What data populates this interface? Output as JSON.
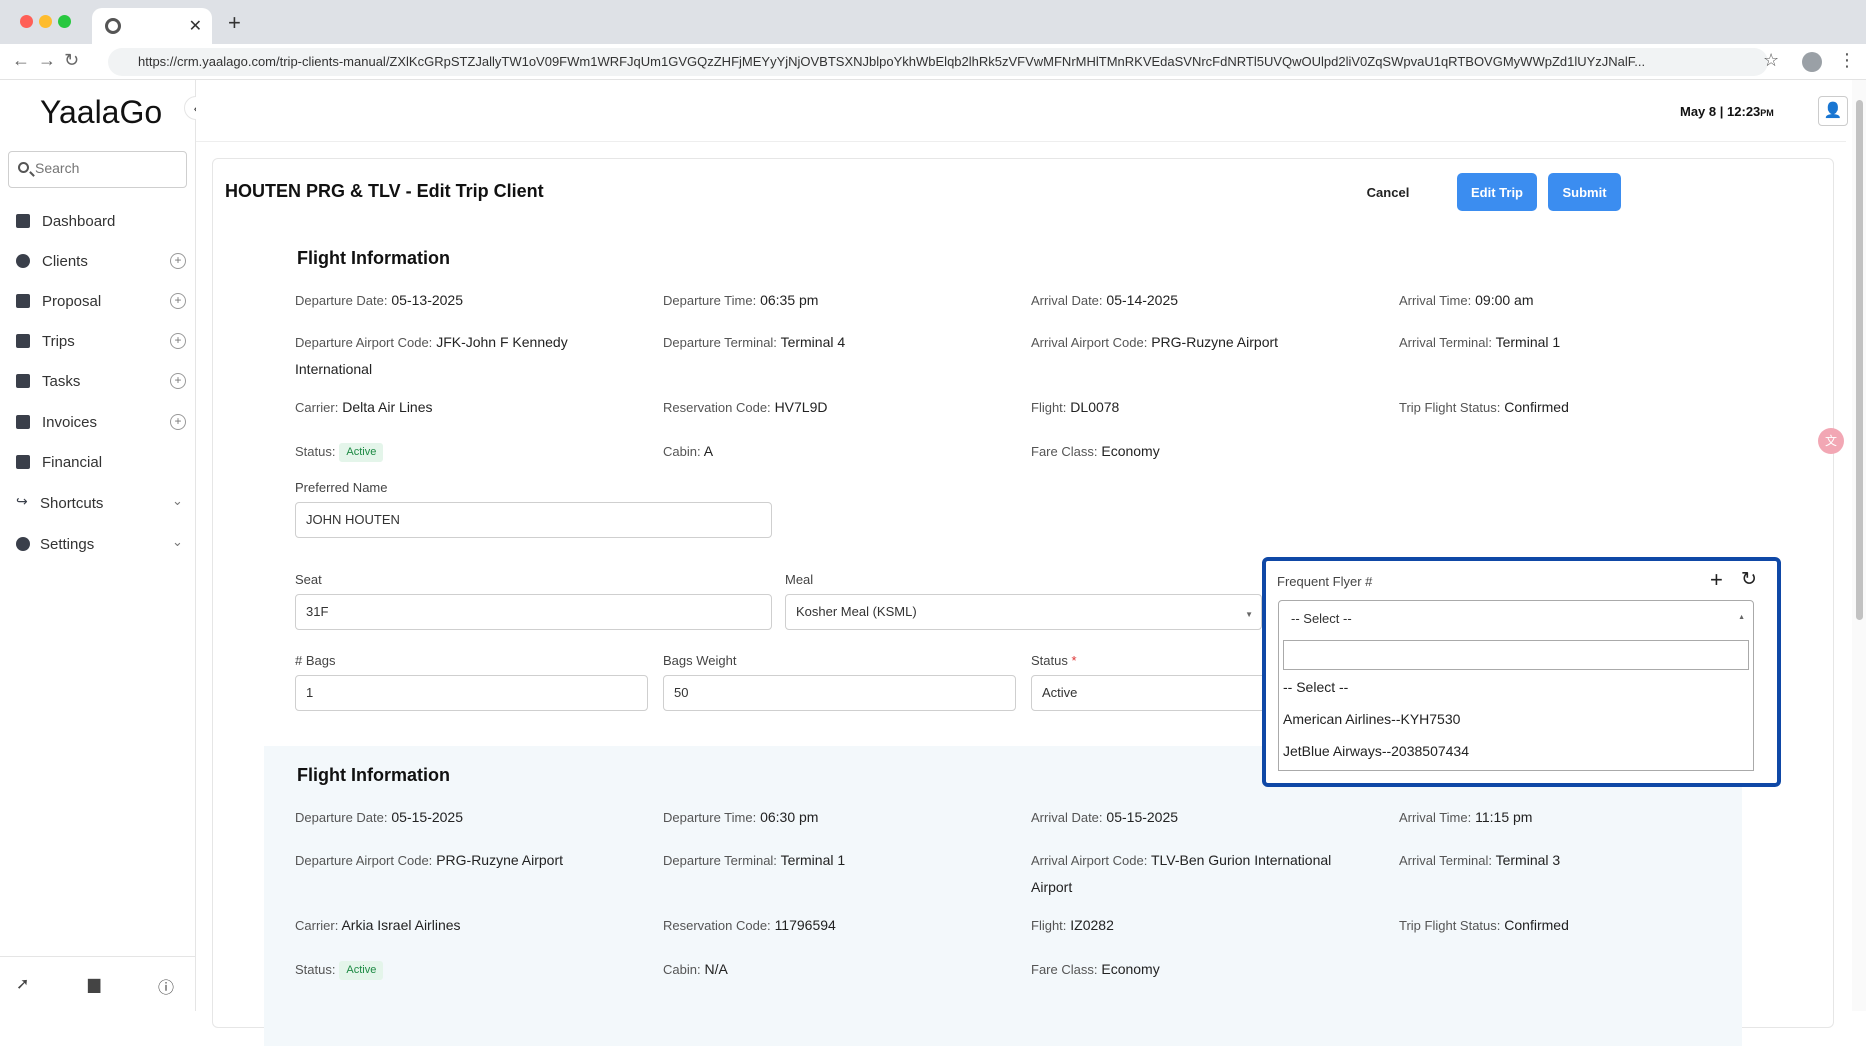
{
  "browser": {
    "tab_close": "✕",
    "new_tab": "+",
    "url": "https://crm.yaalago.com/trip-clients-manual/ZXlKcGRpSTZJallyTW1oV09FWm1WRFJqUm1GVGQzZHFjMEYyYjNjOVBTSXNJblpoYkhWbElqb2lhRk5zVFVwMFNrMHlTMnRKVEdaSVNrcFdNRTl5UVQwOUlpd2liV0ZqSWpvaU1qRTBOVGMyWWpZd1lUYzJNalF..."
  },
  "sidebar": {
    "logo": "YaalaGo",
    "search_placeholder": "Search",
    "items": [
      {
        "label": "Dashboard"
      },
      {
        "label": "Clients"
      },
      {
        "label": "Proposal"
      },
      {
        "label": "Trips"
      },
      {
        "label": "Tasks"
      },
      {
        "label": "Invoices"
      },
      {
        "label": "Financial"
      },
      {
        "label": "Shortcuts"
      },
      {
        "label": "Settings"
      }
    ]
  },
  "header": {
    "date": "May 8",
    "separator": "|",
    "time": "12:23",
    "ampm": "PM"
  },
  "page": {
    "title": "HOUTEN PRG & TLV - Edit Trip Client",
    "cancel": "Cancel",
    "edit_trip": "Edit Trip",
    "submit": "Submit"
  },
  "flight1": {
    "section_title": "Flight Information",
    "departure_date_k": "Departure Date:",
    "departure_date": "05-13-2025",
    "departure_time_k": "Departure Time:",
    "departure_time": "06:35 pm",
    "arrival_date_k": "Arrival Date:",
    "arrival_date": "05-14-2025",
    "arrival_time_k": "Arrival Time:",
    "arrival_time": "09:00 am",
    "dep_airport_k": "Departure Airport Code:",
    "dep_airport_1": "JFK-John F Kennedy",
    "dep_airport_2": "International",
    "dep_terminal_k": "Departure Terminal:",
    "dep_terminal": "Terminal 4",
    "arr_airport_k": "Arrival Airport Code:",
    "arr_airport": "PRG-Ruzyne Airport",
    "arr_terminal_k": "Arrival Terminal:",
    "arr_terminal": "Terminal 1",
    "carrier_k": "Carrier:",
    "carrier": "Delta Air Lines",
    "reservation_k": "Reservation Code:",
    "reservation": "HV7L9D",
    "flight_k": "Flight:",
    "flight": "DL0078",
    "trip_status_k": "Trip Flight Status:",
    "trip_status": "Confirmed",
    "status_k": "Status:",
    "status": "Active",
    "cabin_k": "Cabin:",
    "cabin": "A",
    "fare_k": "Fare Class:",
    "fare": "Economy",
    "preferred_name_label": "Preferred Name",
    "preferred_name": "JOHN HOUTEN",
    "seat_label": "Seat",
    "seat": "31F",
    "meal_label": "Meal",
    "meal": "Kosher Meal (KSML)",
    "bags_label": "# Bags",
    "bags": "1",
    "bags_weight_label": "Bags Weight",
    "bags_weight": "50",
    "status_label": "Status",
    "status_required": "*",
    "status_value": "Active"
  },
  "frequent_flyer": {
    "label": "Frequent Flyer #",
    "selected": "-- Select --",
    "options": [
      "-- Select --",
      "American Airlines--KYH7530",
      "JetBlue Airways--2038507434"
    ]
  },
  "flight2": {
    "section_title": "Flight Information",
    "departure_date_k": "Departure Date:",
    "departure_date": "05-15-2025",
    "departure_time_k": "Departure Time:",
    "departure_time": "06:30 pm",
    "arrival_date_k": "Arrival Date:",
    "arrival_date": "05-15-2025",
    "arrival_time_k": "Arrival Time:",
    "arrival_time": "11:15 pm",
    "dep_airport_k": "Departure Airport Code:",
    "dep_airport": "PRG-Ruzyne Airport",
    "dep_terminal_k": "Departure Terminal:",
    "dep_terminal": "Terminal 1",
    "arr_airport_k": "Arrival Airport Code:",
    "arr_airport_1": "TLV-Ben Gurion International",
    "arr_airport_2": "Airport",
    "arr_terminal_k": "Arrival Terminal:",
    "arr_terminal": "Terminal 3",
    "carrier_k": "Carrier:",
    "carrier": "Arkia Israel Airlines",
    "reservation_k": "Reservation Code:",
    "reservation": "11796594",
    "flight_k": "Flight:",
    "flight": "IZ0282",
    "trip_status_k": "Trip Flight Status:",
    "trip_status": "Confirmed",
    "status_k": "Status:",
    "status": "Active",
    "cabin_k": "Cabin:",
    "cabin": "N/A",
    "fare_k": "Fare Class:",
    "fare": "Economy"
  }
}
